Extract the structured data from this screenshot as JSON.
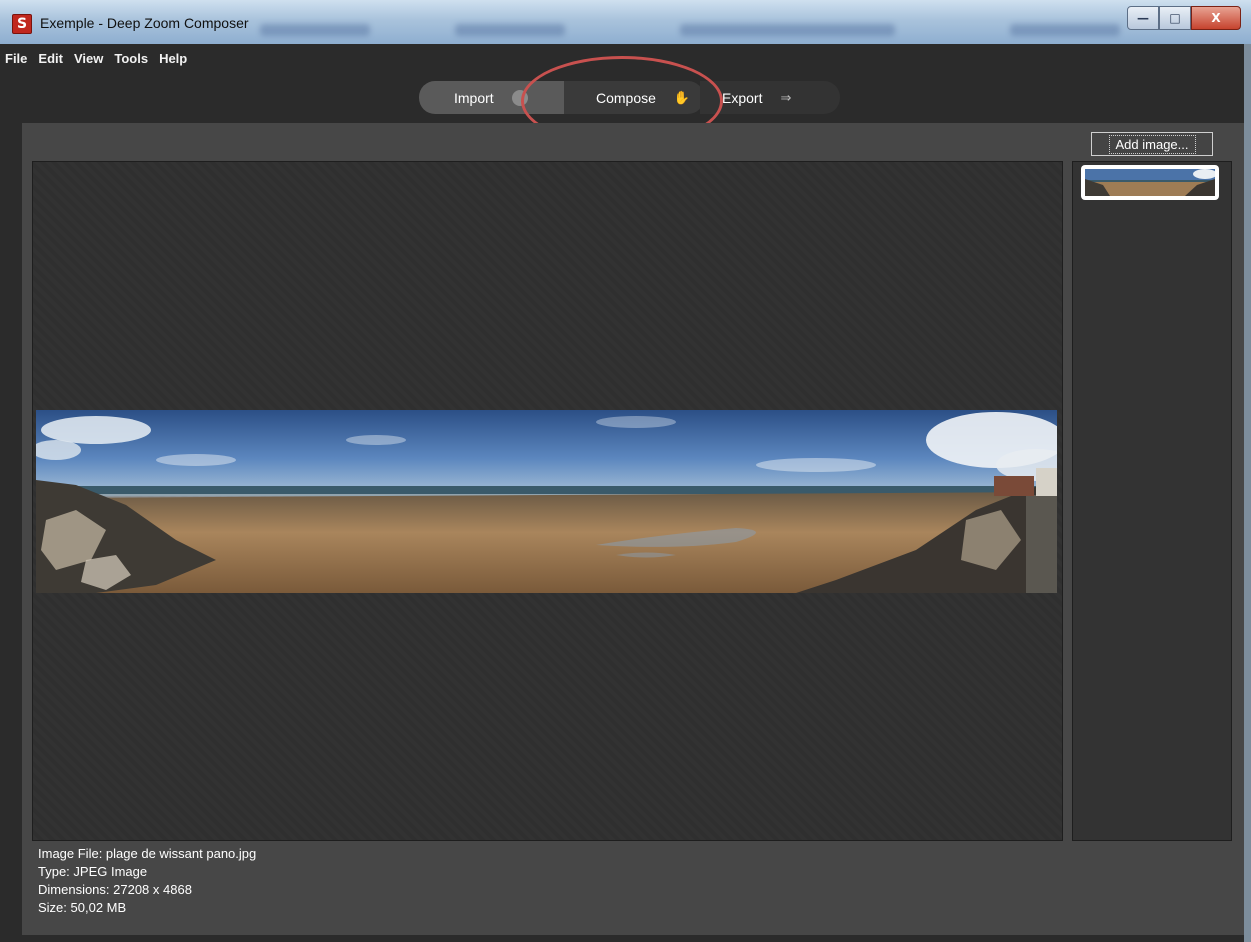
{
  "window": {
    "title": "Exemple - Deep Zoom Composer",
    "app_icon_glyph": "S",
    "controls": {
      "minimize": "—",
      "maximize": "□",
      "close": "X"
    }
  },
  "menu": [
    "File",
    "Edit",
    "View",
    "Tools",
    "Help"
  ],
  "modes": [
    {
      "label": "Import",
      "icon": "import-icon",
      "active": true
    },
    {
      "label": "Compose",
      "icon": "hand-icon",
      "active": false
    },
    {
      "label": "Export",
      "icon": "export-icon",
      "active": false
    }
  ],
  "annotation": {
    "highlight_color": "#c8514f",
    "target": "Compose"
  },
  "sidebar": {
    "add_image_label": "Add image..."
  },
  "image_info": {
    "file": "Image File: plage de wissant pano.jpg",
    "type": "Type: JPEG Image",
    "dimensions": "Dimensions: 27208 x 4868",
    "size": "Size: 50,02 MB"
  },
  "colors": {
    "background": "#2b2b2b",
    "workspace": "#474747",
    "canvas": "#2f2f2f",
    "titlebar": "#a9c3dc"
  }
}
